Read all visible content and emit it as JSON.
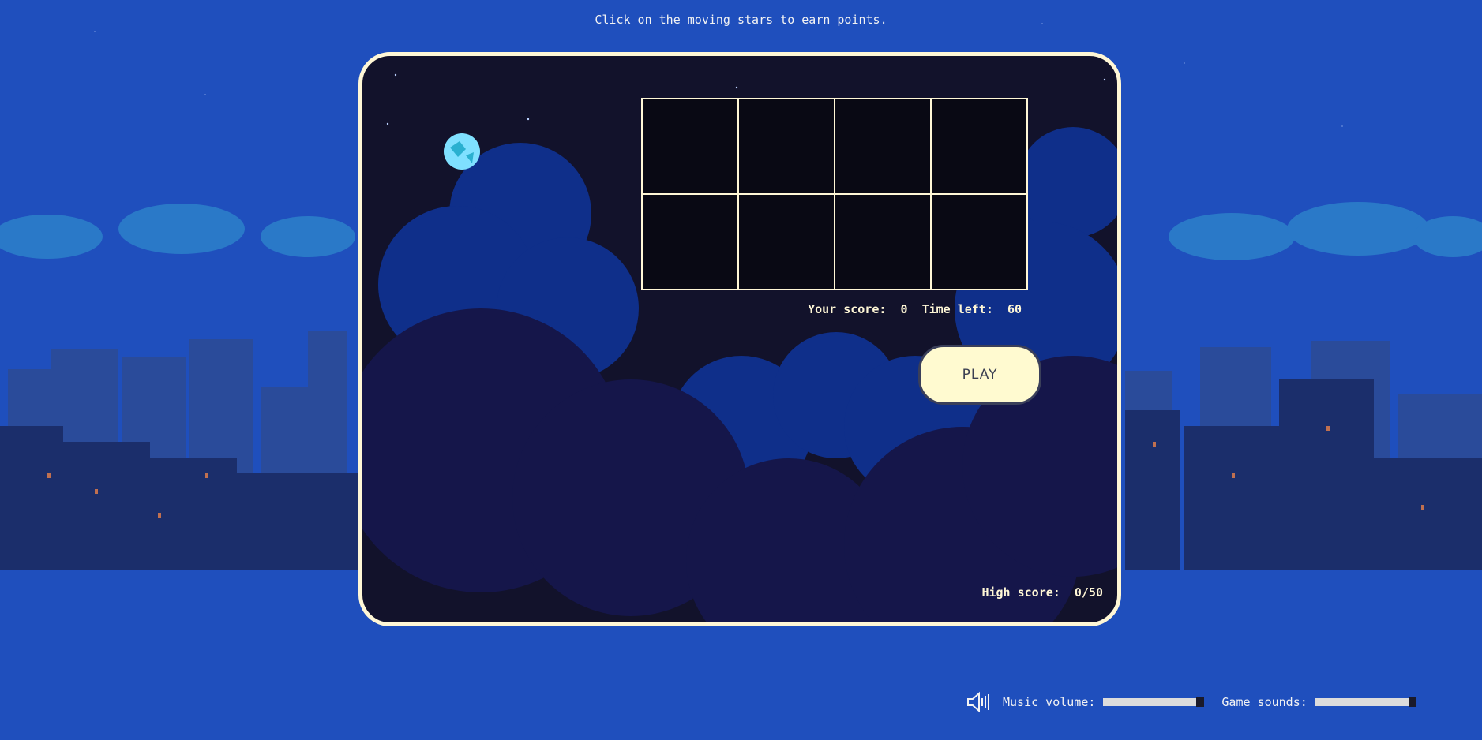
{
  "instructions": "Click on the moving stars to earn points.",
  "score": {
    "label": "Your score:",
    "value": "0"
  },
  "time": {
    "label": "Time left:",
    "value": "60"
  },
  "play_label": "PLAY",
  "high_score": {
    "label": "High score:",
    "value": "0/50"
  },
  "grid_cells": 8,
  "music": {
    "label": "Music volume:",
    "level": 1.0
  },
  "sounds": {
    "label": "Game sounds:",
    "level": 1.0
  },
  "icons": {
    "sound": "speaker-icon",
    "moon": "moon-icon"
  },
  "colors": {
    "sky": "#1f4fbd",
    "panel_bg": "#12122b",
    "border": "#fff7d6",
    "button": "#fffad0"
  }
}
